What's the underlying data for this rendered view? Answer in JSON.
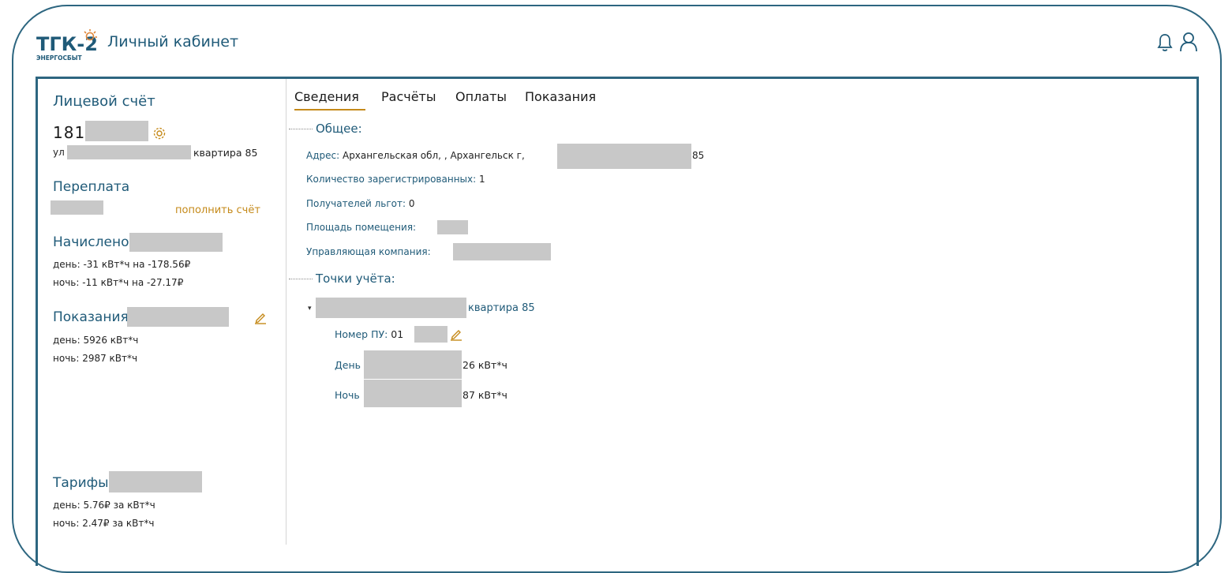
{
  "header": {
    "logo_text": "ТГК-2",
    "logo_subtext": "ЭНЕРГОСБЫТ",
    "title": "Личный кабинет",
    "bell_icon": "bell-icon",
    "user_icon": "user-icon"
  },
  "sidebar": {
    "account_heading": "Лицевой счёт",
    "account_number": "181",
    "address_prefix": "ул",
    "address_suffix": "квартира 85",
    "overpay_heading": "Переплата",
    "topup_link": "пополнить счёт",
    "charged_heading": "Начислено",
    "charged_day": "день: -31 кВт*ч на -178.56₽",
    "charged_night": "ночь: -11 кВт*ч на -27.17₽",
    "readings_heading": "Показания",
    "readings_day": "день: 5926 кВт*ч",
    "readings_night": "ночь: 2987 кВт*ч",
    "tariffs_heading": "Тарифы",
    "tariffs_day": "день: 5.76₽ за кВт*ч",
    "tariffs_night": "ночь: 2.47₽ за кВт*ч"
  },
  "tabs": [
    "Сведения",
    "Расчёты",
    "Оплаты",
    "Показания"
  ],
  "active_tab": "Сведения",
  "general": {
    "title": "Общее:",
    "address_label": "Адрес:",
    "address_value": "Архангельская обл, , Архангельск г,",
    "address_tail": "85",
    "registered_label": "Количество зарегистрированных:",
    "registered_value": "1",
    "benefits_label": "Получателей льгот:",
    "benefits_value": "0",
    "area_label": "Площадь помещения:",
    "company_label": "Управляющая компания:"
  },
  "points": {
    "title": "Точки учёта:",
    "address_suffix": "квартира 85",
    "meter_label": "Номер ПУ:",
    "meter_value": "01",
    "day_label": "День",
    "day_value": "26 кВт*ч",
    "night_label": "Ночь",
    "night_value": "87 кВт*ч"
  },
  "colors": {
    "brand": "#1f5a78",
    "accent": "#c58a1a",
    "border": "#2d6680",
    "redaction": "#c8c8c8"
  }
}
